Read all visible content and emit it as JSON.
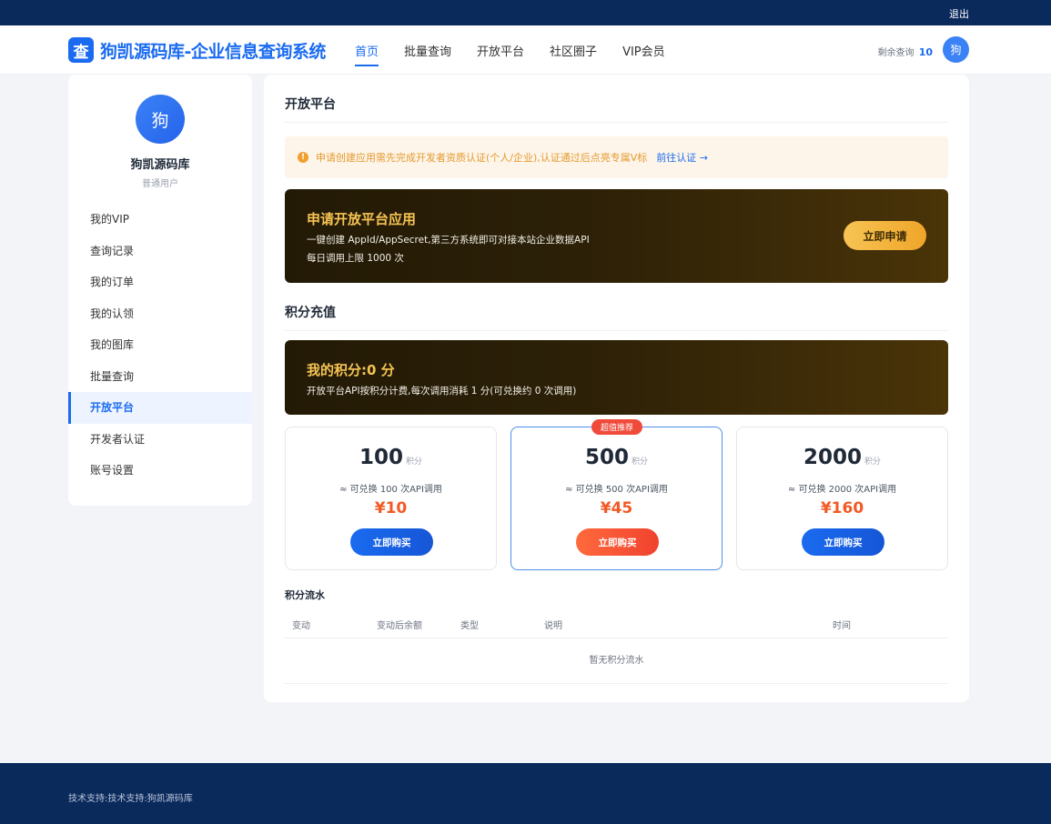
{
  "topbar": {
    "logout": "退出"
  },
  "header": {
    "logo_char": "查",
    "site_title": "狗凯源码库-企业信息查询系统",
    "nav": [
      "首页",
      "批量查询",
      "开放平台",
      "社区圈子",
      "VIP会员"
    ],
    "active_nav": "首页",
    "quota_label": "剩余查询",
    "quota_value": "10",
    "avatar_char": "狗"
  },
  "sidebar": {
    "avatar_char": "狗",
    "user_name": "狗凯源码库",
    "user_role": "普通用户",
    "items": [
      "我的VIP",
      "查询记录",
      "我的订单",
      "我的认领",
      "我的图库",
      "批量查询",
      "开放平台",
      "开发者认证",
      "账号设置"
    ],
    "active_item": "开放平台"
  },
  "main": {
    "open_platform_title": "开放平台",
    "notice": {
      "icon": "!",
      "text": "申请创建应用需先完成开发者资质认证(个人/企业),认证通过后点亮专属V标",
      "link": "前往认证 →"
    },
    "apply_card": {
      "title": "申请开放平台应用",
      "desc1": "一键创建 AppId/AppSecret,第三方系统即可对接本站企业数据API",
      "desc2": "每日调用上限 1000 次",
      "button": "立即申请"
    },
    "points_title": "积分充值",
    "points_card": {
      "title": "我的积分:0 分",
      "desc": "开放平台API按积分计费,每次调用消耗 1 分(可兑换约 0 次调用)"
    },
    "packages": [
      {
        "amount": "100",
        "unit": "积分",
        "desc": "≈ 可兑换 100 次API调用",
        "price": "¥10",
        "button": "立即购买",
        "badge": ""
      },
      {
        "amount": "500",
        "unit": "积分",
        "desc": "≈ 可兑换 500 次API调用",
        "price": "¥45",
        "button": "立即购买",
        "badge": "超值推荐"
      },
      {
        "amount": "2000",
        "unit": "积分",
        "desc": "≈ 可兑换 2000 次API调用",
        "price": "¥160",
        "button": "立即购买",
        "badge": ""
      }
    ],
    "flow": {
      "title": "积分流水",
      "columns": [
        "变动",
        "变动后余额",
        "类型",
        "说明",
        "时间"
      ],
      "empty": "暂无积分流水"
    }
  },
  "footer": {
    "text": "技术支持:技术支持:狗凯源码库"
  }
}
